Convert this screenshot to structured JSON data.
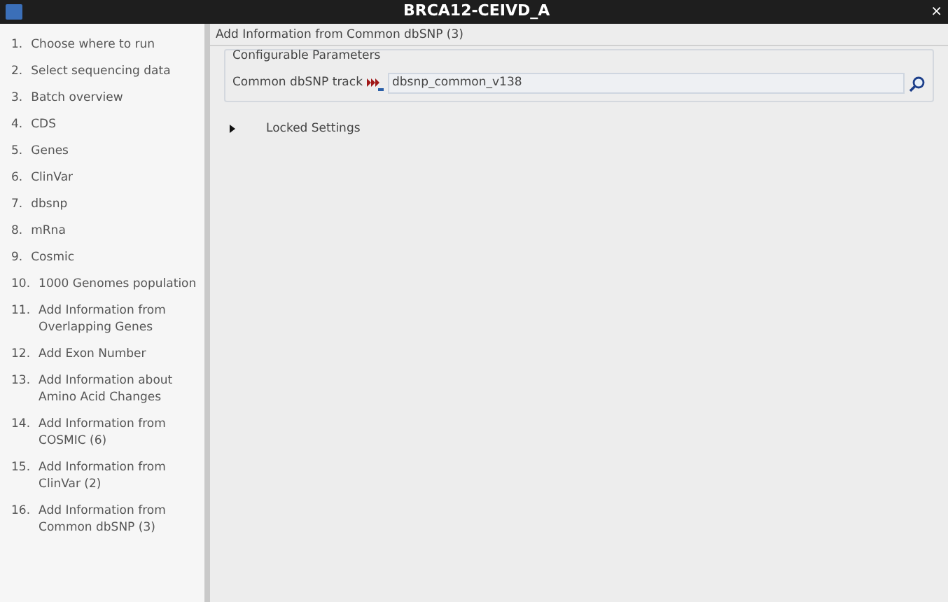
{
  "window": {
    "title": "BRCA12-CEIVD_A",
    "close": "×"
  },
  "steps": [
    {
      "number": "1.",
      "label": "Choose where to run"
    },
    {
      "number": "2.",
      "label": "Select sequencing data"
    },
    {
      "number": "3.",
      "label": "Batch overview"
    },
    {
      "number": "4.",
      "label": "CDS"
    },
    {
      "number": "5.",
      "label": "Genes"
    },
    {
      "number": "6.",
      "label": "ClinVar"
    },
    {
      "number": "7.",
      "label": "dbsnp"
    },
    {
      "number": "8.",
      "label": "mRna"
    },
    {
      "number": "9.",
      "label": "Cosmic"
    },
    {
      "number": "10.",
      "label": "1000 Genomes population"
    },
    {
      "number": "11.",
      "label": "Add Information from Overlapping Genes"
    },
    {
      "number": "12.",
      "label": "Add Exon Number"
    },
    {
      "number": "13.",
      "label": "Add Information about Amino Acid Changes"
    },
    {
      "number": "14.",
      "label": "Add Information from COSMIC (6)"
    },
    {
      "number": "15.",
      "label": "Add Information from ClinVar (2)"
    },
    {
      "number": "16.",
      "label": "Add Information from Common dbSNP (3)"
    }
  ],
  "panel": {
    "title": "Add Information from Common dbSNP (3)",
    "group": {
      "title": "Configurable Parameters",
      "field_label": "Common dbSNP track",
      "value": "dbsnp_common_v138"
    },
    "locked": {
      "label": "Locked Settings",
      "expanded": false
    }
  }
}
